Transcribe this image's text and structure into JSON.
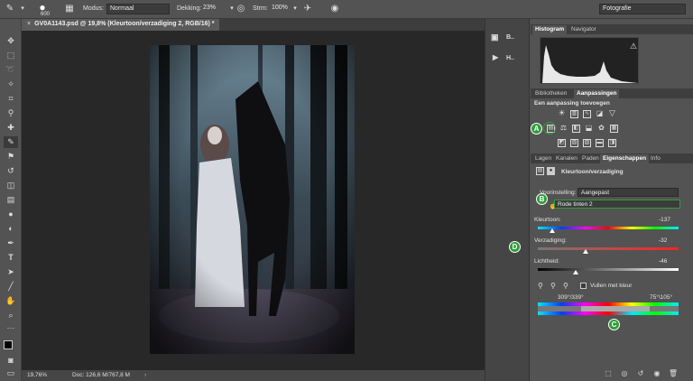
{
  "options_bar": {
    "brush_size": "600",
    "mode_label": "Modus:",
    "mode_value": "Normaal",
    "opacity_label": "Dekking:",
    "opacity_value": "23%",
    "flow_label": "Strm:",
    "flow_value": "100%",
    "workspace": "Fotografie"
  },
  "document": {
    "tab_title": "GV0A1143.psd @ 19,8% (Kleurtoon/verzadiging 2, RGB/16) *",
    "zoom": "19,76%",
    "doc_size": "Doc: 126,6 M/767,8 M"
  },
  "dock": {
    "items": [
      {
        "label": "B..",
        "icon": "brush-presets-icon"
      },
      {
        "label": "H..",
        "icon": "history-play-icon"
      }
    ]
  },
  "histogram_panel": {
    "tabs": [
      "Histogram",
      "Navigator"
    ],
    "active_tab": "Histogram",
    "warning_icon": "warning-icon"
  },
  "adjustments_panel": {
    "tabs": [
      "Bibliotheken",
      "Aanpassingen"
    ],
    "active_tab": "Aanpassingen",
    "heading": "Een aanpassing toevoegen"
  },
  "properties_panel": {
    "tabs": [
      "Lagen",
      "Kanalen",
      "Paden",
      "Eigenschappen",
      "Info"
    ],
    "active_tab": "Eigenschappen",
    "title": "Kleurtoon/verzadiging",
    "preset_label": "Voorinstelling:",
    "preset_value": "Aangepast",
    "channel_value": "Rode tinten 2",
    "hue_label": "Kleurtoon:",
    "hue_value": "-137",
    "saturation_label": "Verzadiging:",
    "saturation_value": "-32",
    "lightness_label": "Lichtheid:",
    "lightness_value": "-46",
    "colorize_label": "Vullen met kleur",
    "range_left": "309°/339°",
    "range_right": "75°\\105°",
    "hue_level": 0.1,
    "saturation_level": 0.34,
    "lightness_level": 0.27
  },
  "annotations": {
    "a": "A",
    "b": "B",
    "c": "C",
    "d": "D"
  },
  "colors": {
    "accent_marker": "#2e9e3a",
    "panel_bg": "#535353",
    "canvas_bg": "#282828"
  }
}
